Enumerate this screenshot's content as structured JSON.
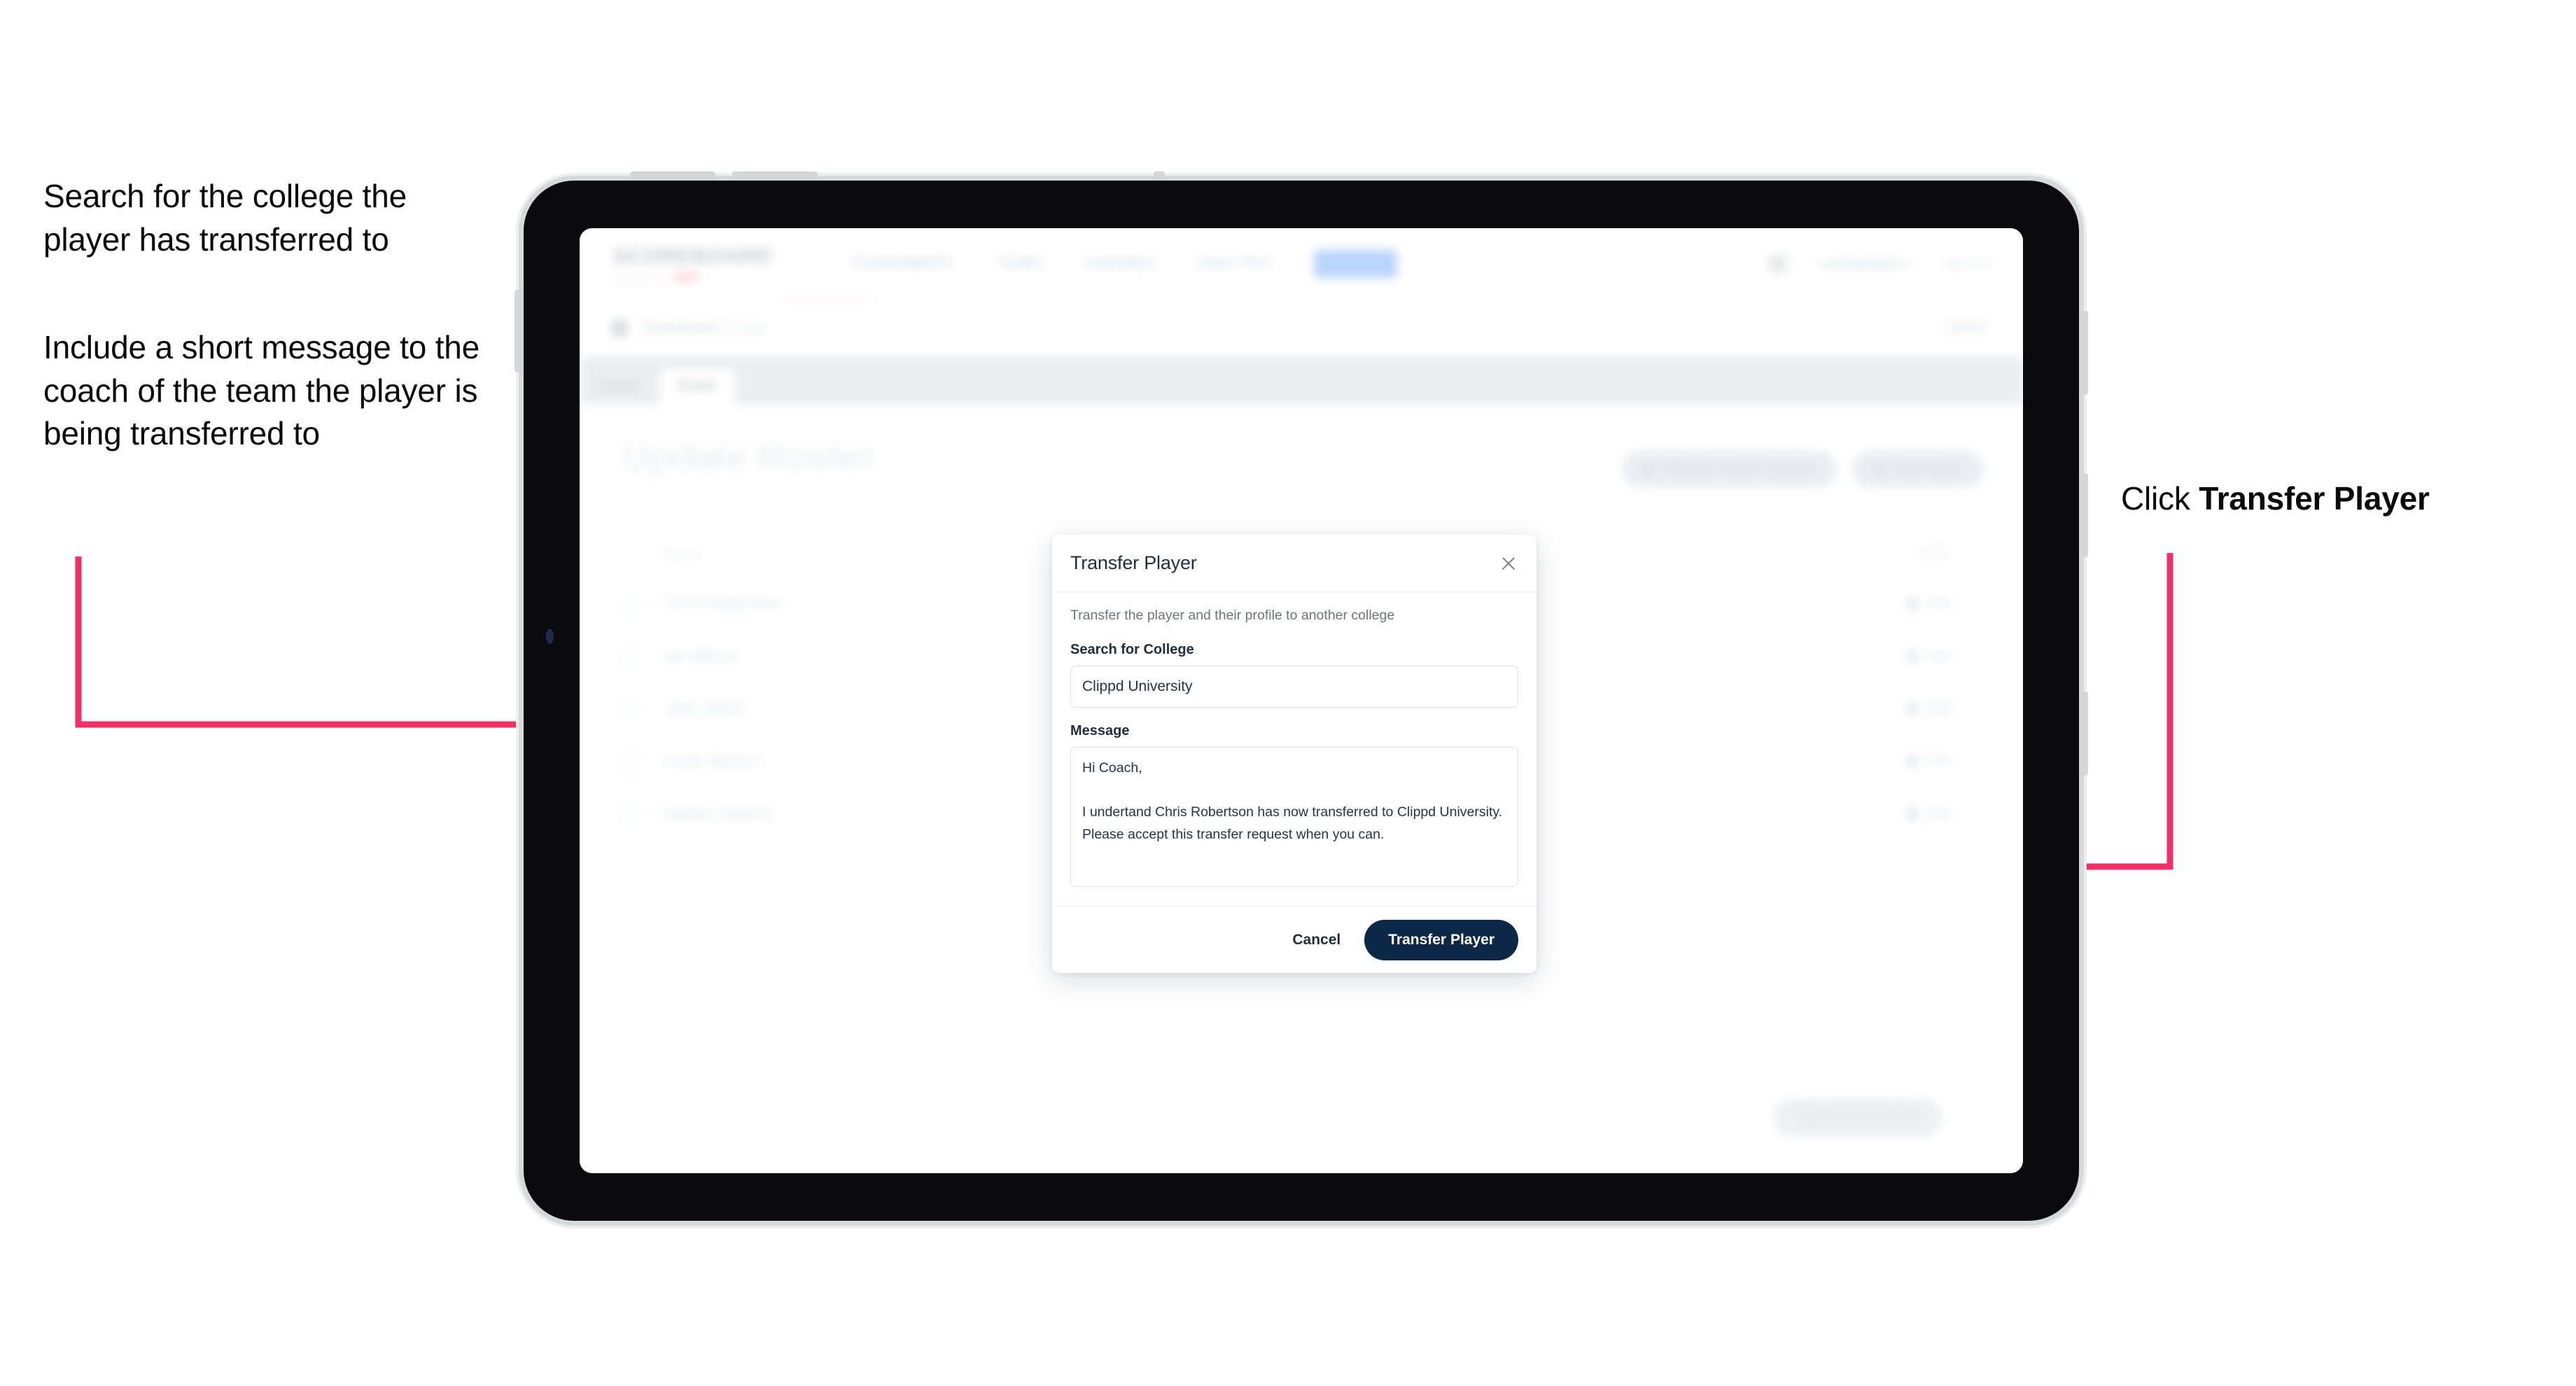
{
  "annotations": {
    "left_1": "Search for the college the player has transferred to",
    "left_2": "Include a short message to the coach of the team the player is being transferred to",
    "right_prefix": "Click ",
    "right_bold": "Transfer Player"
  },
  "colors": {
    "arrow": "#f52f63",
    "primary_button": "#0d2847",
    "modal_border": "#dde1e6",
    "tablet_body": "#0b0b0d",
    "tablet_bezel": "#d7d9db"
  },
  "app": {
    "logo": "SCOREBOARD",
    "logo_sub": "powered by",
    "nav_items": [
      "TOURNAMENTS",
      "TEAMS",
      "RANKINGS",
      "ANALYTICS"
    ],
    "nav_pill": "ROSTER",
    "user_email": "coach@clippd.io",
    "sign_out": "Sign Out",
    "breadcrumb": "Scoreboard",
    "breadcrumb_sub": "/ Roster",
    "breadcrumb_right": "Cancel",
    "tabs": [
      "Details",
      "Roster"
    ],
    "active_tab": "Roster",
    "page_title": "Update Roster",
    "header_buttons": [
      "Request Player Transfer",
      "Add Player"
    ],
    "table_headers": {
      "name": "Name",
      "edit": "EDIT"
    },
    "rows": [
      {
        "name": "Chris Robertson",
        "action": "Edit"
      },
      {
        "name": "Ian Wilson",
        "action": "Edit"
      },
      {
        "name": "Jake Taylor",
        "action": "Edit"
      },
      {
        "name": "Lewis Barnes",
        "action": "Edit"
      },
      {
        "name": "Nathan Holmes",
        "action": "Edit"
      }
    ],
    "footer_button": "Save And Continue"
  },
  "modal": {
    "title": "Transfer Player",
    "close_icon": "close-icon",
    "description": "Transfer the player and their profile to another college",
    "college_label": "Search for College",
    "college_value": "Clippd University",
    "college_placeholder": "Search for College",
    "message_label": "Message",
    "message_value": "Hi Coach,\n\nI undertand Chris Robertson has now transferred to Clippd University. Please accept this transfer request when you can.",
    "message_placeholder": "Message",
    "cancel_label": "Cancel",
    "submit_label": "Transfer Player"
  }
}
